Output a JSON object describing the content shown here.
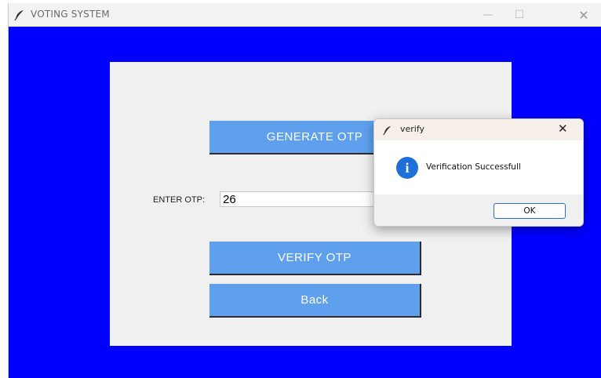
{
  "window": {
    "title": "VOTING SYSTEM",
    "minimize_glyph": "—",
    "maximize_glyph": "☐",
    "close_glyph": "✕"
  },
  "colors": {
    "background": "#0000ff",
    "panel": "#f0f0f0",
    "button": "#5fa0ee",
    "info_icon": "#1e6fd9"
  },
  "panel": {
    "generate_label": "GENERATE OTP",
    "otp_label": "ENTER OTP:",
    "otp_value": "26",
    "verify_label": "VERIFY OTP",
    "back_label": "Back"
  },
  "dialog": {
    "title": "verify",
    "close_glyph": "✕",
    "icon_glyph": "i",
    "message": "Verification Successfull",
    "ok_label": "OK"
  },
  "icons": {
    "app": "feather-icon",
    "dialog_title": "feather-icon",
    "message": "info-icon"
  }
}
